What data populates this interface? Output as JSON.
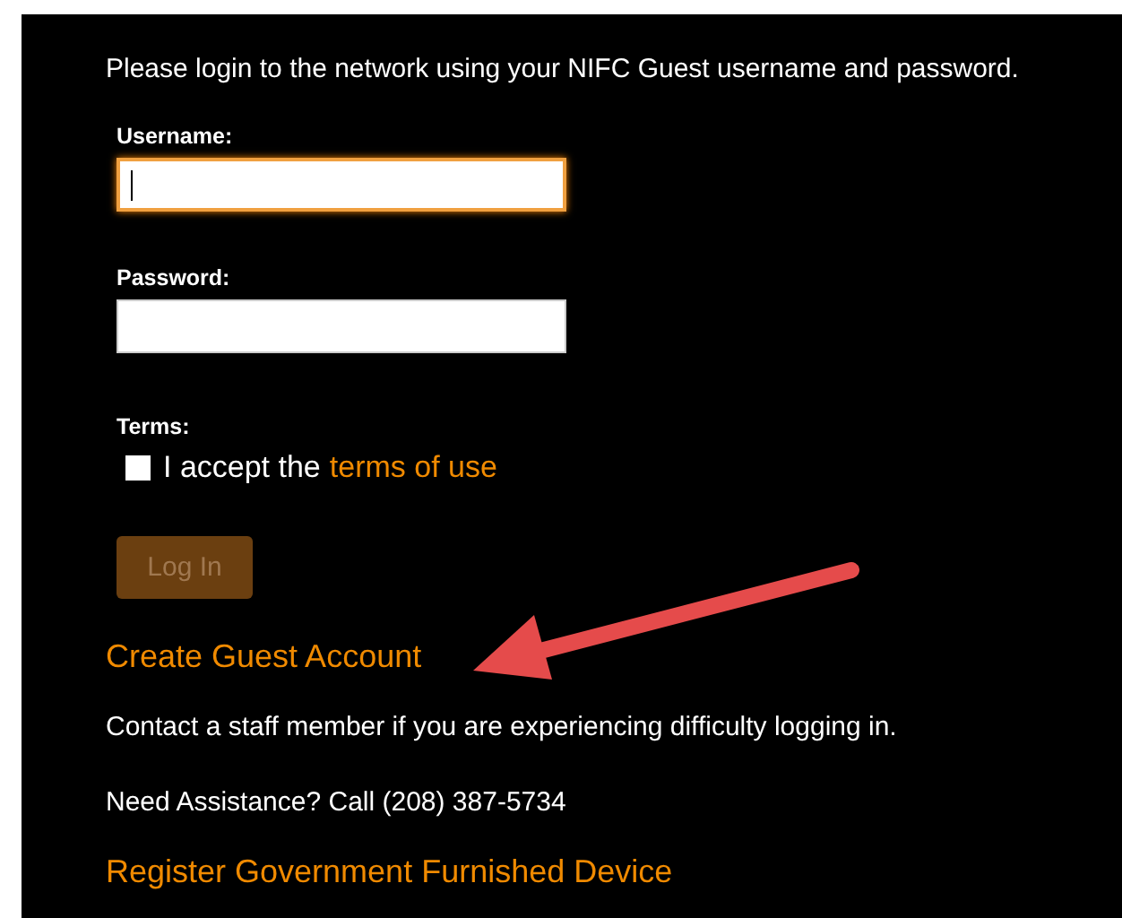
{
  "intro": "Please login to the network using your NIFC Guest username and password.",
  "fields": [
    {
      "label": "Username:",
      "focused": true,
      "cursor": true
    },
    {
      "label": "Password:",
      "focused": false,
      "cursor": false
    }
  ],
  "terms": {
    "label": "Terms:",
    "checked": false,
    "text": "I accept the",
    "link": "terms of use"
  },
  "login_button": {
    "label": "Log In",
    "disabled": true
  },
  "create_link": "Create Guest Account",
  "contact": "Contact a staff member if you are experiencing difficulty logging in.",
  "assistance": "Need Assistance? Call (208) 387-5734",
  "register_link": "Register Government Furnished Device"
}
